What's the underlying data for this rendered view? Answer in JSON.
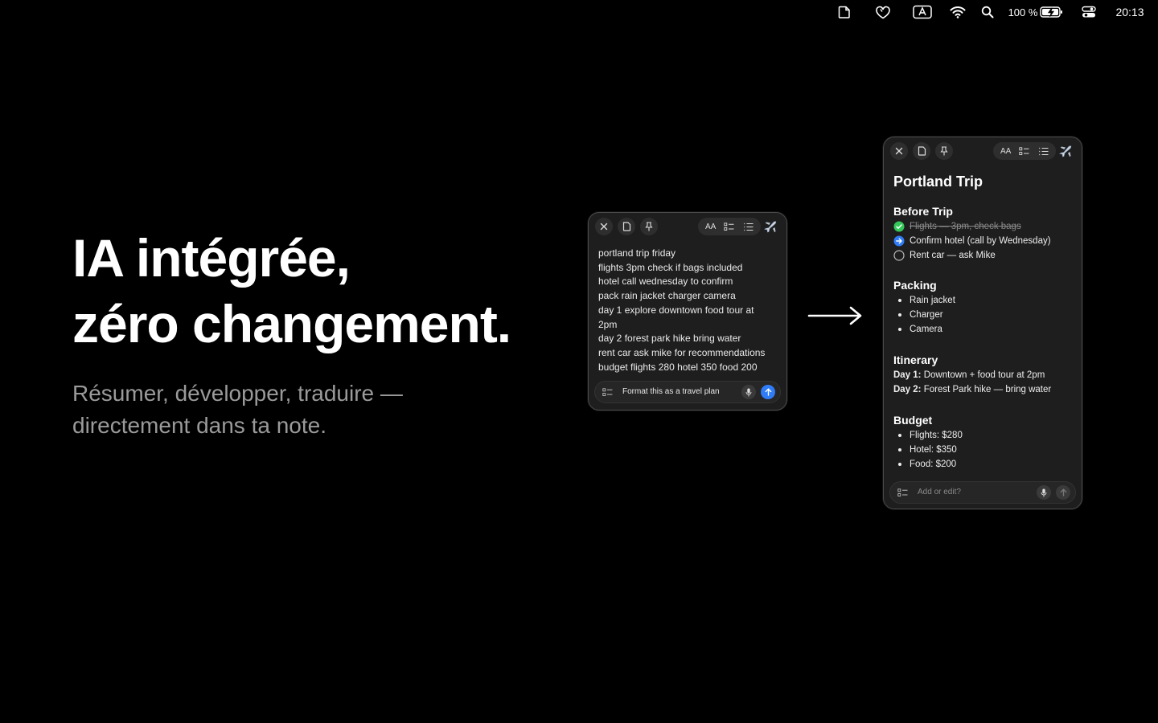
{
  "menubar": {
    "battery": "100 %",
    "time": "20:13",
    "icons": [
      "note-icon",
      "heart-shield-icon",
      "keyboard-a-icon",
      "wifi-icon",
      "search-icon",
      "battery-charging-icon",
      "control-center-icon"
    ]
  },
  "hero": {
    "headline_line1": "IA intégrée,",
    "headline_line2": "zéro changement.",
    "sub_line1": "Résumer, développer, traduire —",
    "sub_line2": "directement dans ta note."
  },
  "note_before": {
    "toolbar": {
      "font_size_label": "AA"
    },
    "lines": [
      "portland trip friday",
      "flights 3pm check if bags included",
      "hotel call wednesday to confirm",
      "pack rain jacket charger camera",
      "day 1 explore downtown food tour at",
      "2pm",
      "day 2 forest park hike bring water",
      "rent car ask mike for recommendations",
      "budget flights 280 hotel 350 food 200"
    ],
    "prompt": "Format this as a travel plan"
  },
  "note_after": {
    "toolbar": {
      "font_size_label": "AA"
    },
    "title": "Portland Trip",
    "before_trip": {
      "heading": "Before Trip",
      "tasks": [
        {
          "text": "Flights — 3pm, check bags",
          "state": "done"
        },
        {
          "text": "Confirm hotel (call by Wednesday)",
          "state": "in-progress"
        },
        {
          "text": "Rent car — ask Mike",
          "state": "todo"
        }
      ]
    },
    "packing": {
      "heading": "Packing",
      "items": [
        "Rain jacket",
        "Charger",
        "Camera"
      ]
    },
    "itinerary": {
      "heading": "Itinerary",
      "days": [
        {
          "label": "Day 1:",
          "text": " Downtown + food tour at 2pm"
        },
        {
          "label": "Day 2:",
          "text": " Forest Park hike — bring water"
        }
      ]
    },
    "budget": {
      "heading": "Budget",
      "items": [
        "Flights: $280",
        "Hotel: $350",
        "Food: $200"
      ]
    },
    "prompt_placeholder": "Add or edit?"
  },
  "colors": {
    "background": "#000000",
    "window": "#1e1e1e",
    "accent_blue": "#2f7cf6",
    "done_green": "#34c759",
    "muted_text": "#9a9a9a"
  }
}
